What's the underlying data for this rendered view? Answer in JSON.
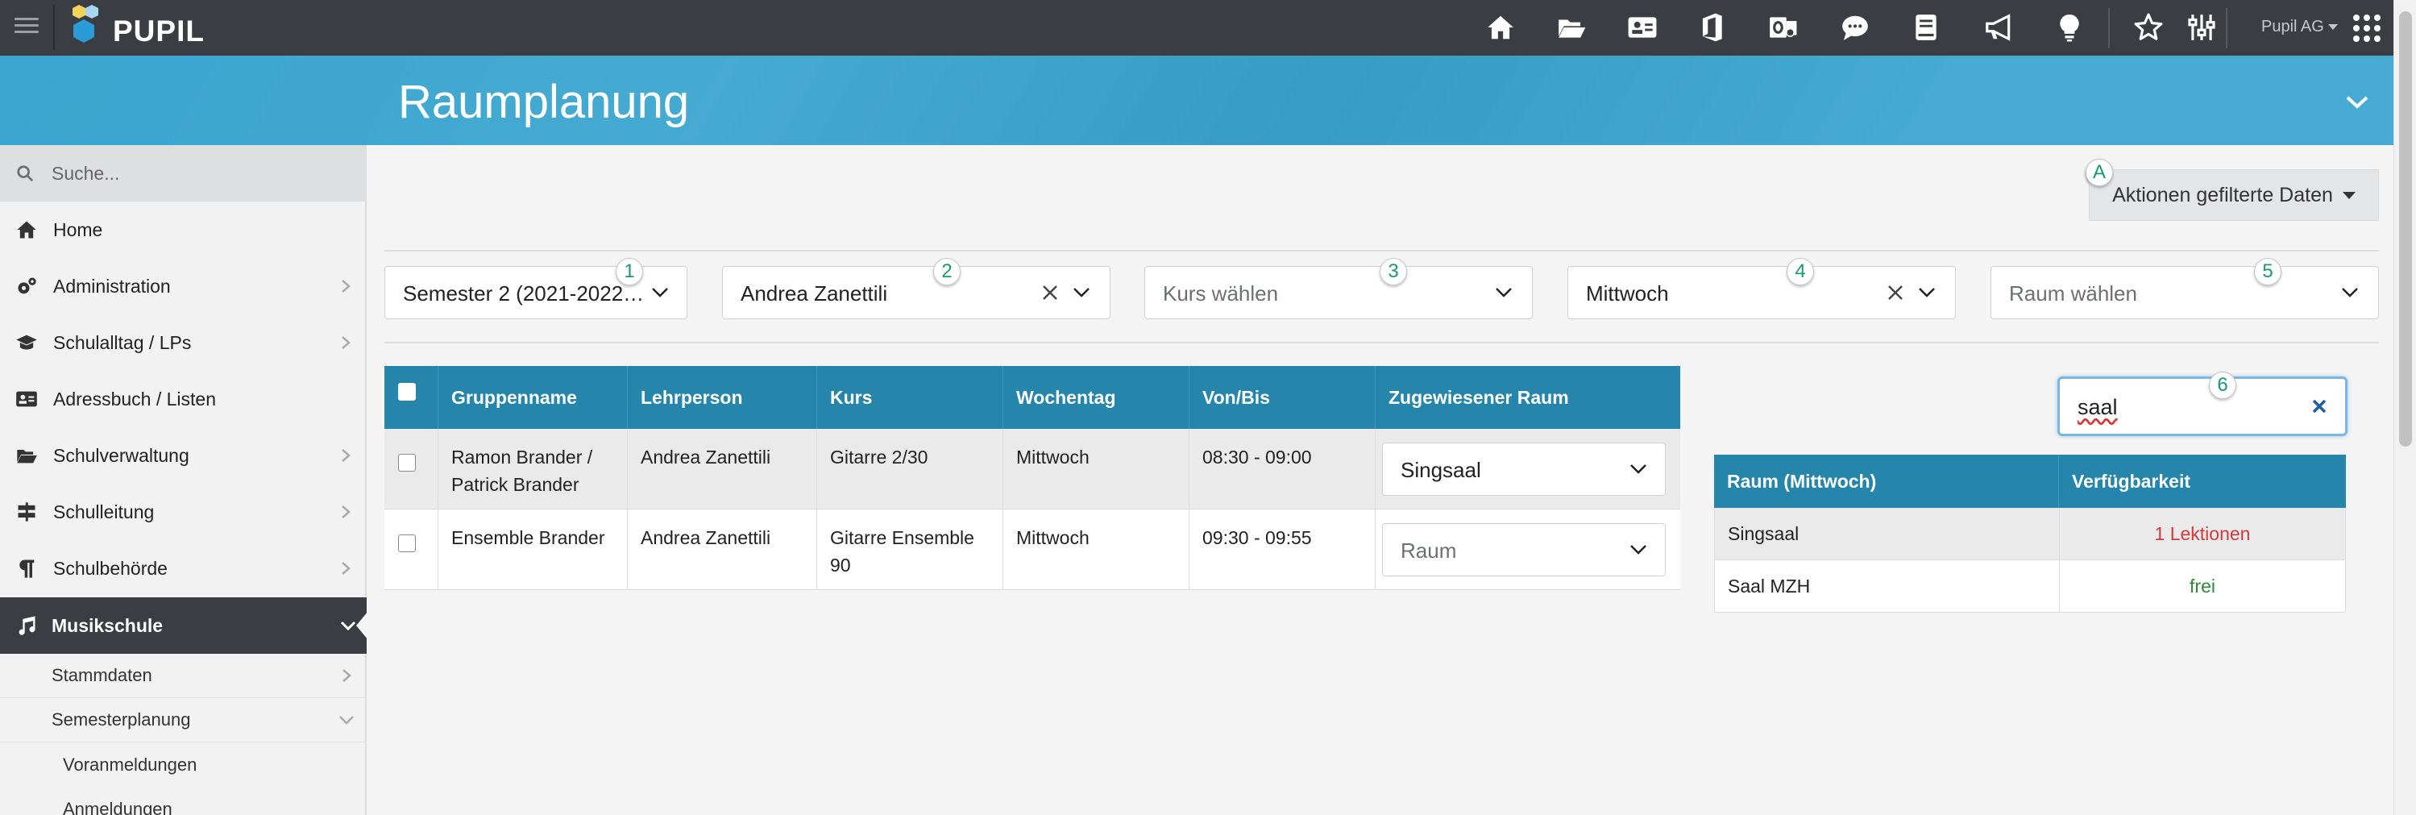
{
  "app": {
    "logo_text": "PUPIL",
    "user": "Pupil AG"
  },
  "header": {
    "title": "Raumplanung"
  },
  "sidebar": {
    "search_placeholder": "Suche...",
    "items": [
      {
        "label": "Home",
        "icon": "home-icon"
      },
      {
        "label": "Administration",
        "icon": "cogs-icon"
      },
      {
        "label": "Schulalltag / LPs",
        "icon": "graduation-cap-icon"
      },
      {
        "label": "Adressbuch / Listen",
        "icon": "address-card-icon"
      },
      {
        "label": "Schulverwaltung",
        "icon": "folder-open-icon"
      },
      {
        "label": "Schulleitung",
        "icon": "signpost-icon"
      },
      {
        "label": "Schulbehörde",
        "icon": "paragraph-icon"
      },
      {
        "label": "Musikschule",
        "icon": "music-icon"
      }
    ],
    "sub_items": [
      {
        "label": "Stammdaten"
      },
      {
        "label": "Semesterplanung"
      }
    ],
    "subsub_items": [
      {
        "label": "Voranmeldungen"
      },
      {
        "label": "Anmeldungen"
      }
    ]
  },
  "actions": {
    "label": "Aktionen gefilterte Daten",
    "badge": "A"
  },
  "filters": [
    {
      "value": "Semester 2 (2021-2022…",
      "badge": "1"
    },
    {
      "value": "Andrea Zanettili",
      "badge": "2"
    },
    {
      "placeholder": "Kurs wählen",
      "badge": "3"
    },
    {
      "value": "Mittwoch",
      "badge": "4"
    },
    {
      "placeholder": "Raum wählen",
      "badge": "5"
    }
  ],
  "table": {
    "headers": [
      "Gruppenname",
      "Lehrperson",
      "Kurs",
      "Wochentag",
      "Von/Bis",
      "Zugewiesener Raum"
    ],
    "rows": [
      {
        "gruppe": "Ramon Brander / Patrick Brander",
        "lehrperson": "Andrea Zanettili",
        "kurs": "Gitarre 2/30",
        "tag": "Mittwoch",
        "zeit": "08:30 - 09:00",
        "raum": "Singsaal"
      },
      {
        "gruppe": "Ensemble Brander",
        "lehrperson": "Andrea Zanettili",
        "kurs": "Gitarre Ensemble 90",
        "tag": "Mittwoch",
        "zeit": "09:30 - 09:55",
        "raum": "Raum"
      }
    ]
  },
  "room_search": {
    "value": "saal",
    "badge": "6"
  },
  "room_table": {
    "headers": [
      "Raum (Mittwoch)",
      "Verfügbarkeit"
    ],
    "rows": [
      {
        "raum": "Singsaal",
        "status": "1 Lektionen",
        "status_color": "#d23a3a"
      },
      {
        "raum": "Saal MZH",
        "status": "frei",
        "status_color": "#2f8a3a"
      }
    ]
  },
  "colors": {
    "topbar": "#3a3d42",
    "header": "#3aa5cf",
    "table_header": "#2585aa",
    "badge_text": "#1a9a6a"
  }
}
